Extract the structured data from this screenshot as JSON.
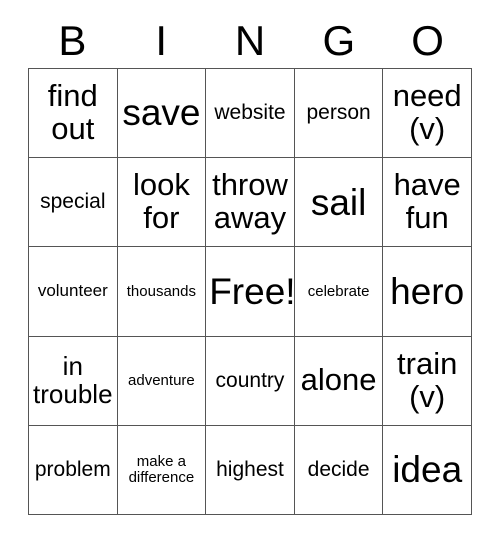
{
  "card": {
    "title": "BINGO",
    "header_letters": [
      "B",
      "I",
      "N",
      "G",
      "O"
    ],
    "free_space_label": "Free!",
    "colors": {
      "text": "#000000",
      "border": "#555555",
      "background": "#ffffff"
    },
    "rows": [
      [
        {
          "text": "find\nout",
          "size": "fs-xl"
        },
        {
          "text": "save",
          "size": "fs-xxl"
        },
        {
          "text": "website",
          "size": "fs-m"
        },
        {
          "text": "person",
          "size": "fs-m"
        },
        {
          "text": "need\n(v)",
          "size": "fs-xl"
        }
      ],
      [
        {
          "text": "special",
          "size": "fs-m"
        },
        {
          "text": "look\nfor",
          "size": "fs-xl"
        },
        {
          "text": "throw\naway",
          "size": "fs-xl"
        },
        {
          "text": "sail",
          "size": "fs-xxl"
        },
        {
          "text": "have\nfun",
          "size": "fs-xl"
        }
      ],
      [
        {
          "text": "volunteer",
          "size": "fs-s"
        },
        {
          "text": "thousands",
          "size": "fs-xs"
        },
        {
          "text": "Free!",
          "size": "fs-xxl"
        },
        {
          "text": "celebrate",
          "size": "fs-xs"
        },
        {
          "text": "hero",
          "size": "fs-xxl"
        }
      ],
      [
        {
          "text": "in\ntrouble",
          "size": "fs-l"
        },
        {
          "text": "adventure",
          "size": "fs-xs"
        },
        {
          "text": "country",
          "size": "fs-m"
        },
        {
          "text": "alone",
          "size": "fs-xl"
        },
        {
          "text": "train\n(v)",
          "size": "fs-xl"
        }
      ],
      [
        {
          "text": "problem",
          "size": "fs-m"
        },
        {
          "text": "make a\ndifference",
          "size": "fs-xs"
        },
        {
          "text": "highest",
          "size": "fs-m"
        },
        {
          "text": "decide",
          "size": "fs-m"
        },
        {
          "text": "idea",
          "size": "fs-xxl"
        }
      ]
    ]
  }
}
